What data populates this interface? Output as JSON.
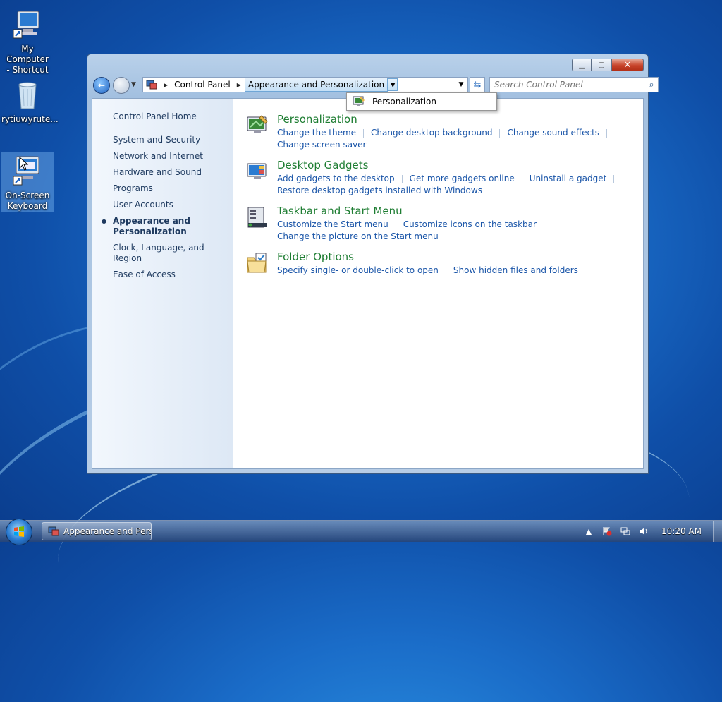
{
  "desktop": {
    "icons": [
      {
        "label_line1": "My Computer",
        "label_line2": "- Shortcut"
      },
      {
        "label_line1": "rytiuwyrute...",
        "label_line2": ""
      },
      {
        "label_line1": "On-Screen",
        "label_line2": "Keyboard"
      }
    ]
  },
  "window": {
    "address": {
      "crumbs": [
        "Control Panel",
        "Appearance and Personalization"
      ]
    },
    "search": {
      "placeholder": "Search Control Panel"
    },
    "breadcrumb_menu": {
      "items": [
        "Personalization"
      ]
    },
    "left_nav": {
      "home": "Control Panel Home",
      "items": [
        "System and Security",
        "Network and Internet",
        "Hardware and Sound",
        "Programs",
        "User Accounts",
        "Appearance and Personalization",
        "Clock, Language, and Region",
        "Ease of Access"
      ],
      "current_line1": "Appearance and",
      "current_line2": "Personalization"
    },
    "categories": [
      {
        "title": "Personalization",
        "links_row1": [
          "Change the theme",
          "Change desktop background",
          "Change sound effects"
        ],
        "links_row2": [
          "Change screen saver"
        ]
      },
      {
        "title": "Desktop Gadgets",
        "links_row1": [
          "Add gadgets to the desktop",
          "Get more gadgets online",
          "Uninstall a gadget"
        ],
        "links_row2": [
          "Restore desktop gadgets installed with Windows"
        ]
      },
      {
        "title": "Taskbar and Start Menu",
        "links_row1": [
          "Customize the Start menu",
          "Customize icons on the taskbar"
        ],
        "links_row2": [
          "Change the picture on the Start menu"
        ]
      },
      {
        "title": "Folder Options",
        "links_row1": [
          "Specify single- or double-click to open",
          "Show hidden files and folders"
        ],
        "links_row2": []
      }
    ]
  },
  "taskbar": {
    "task_label": "Appearance and Pers...",
    "clock": "10:20 AM"
  },
  "colors": {
    "link": "#1a55a8",
    "category_title": "#1e7d32",
    "nav_text": "#1e3a5f"
  }
}
